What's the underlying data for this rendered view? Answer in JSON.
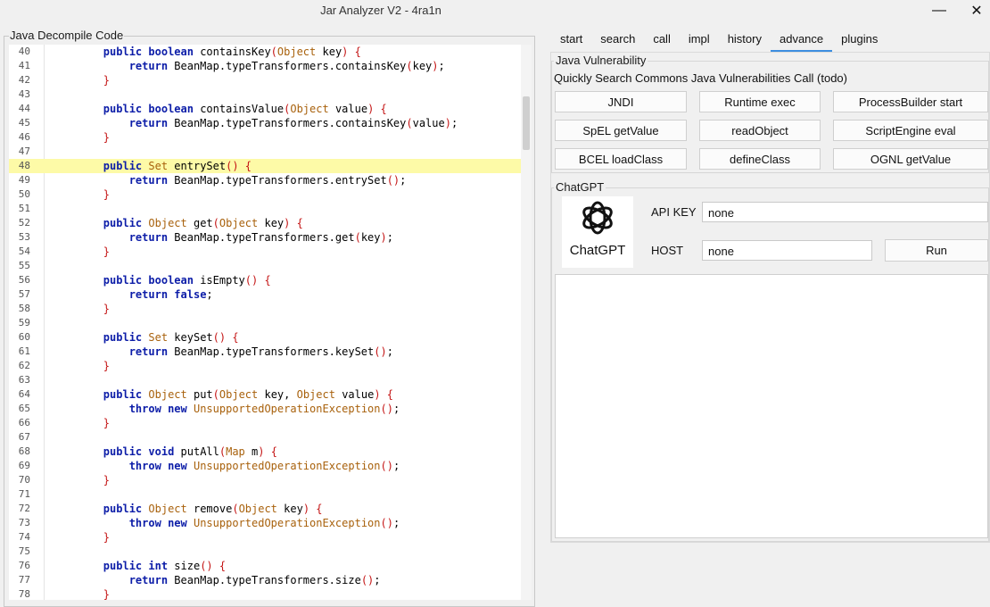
{
  "window": {
    "title": "Jar Analyzer V2 - 4ra1n",
    "minimize": "—",
    "close": "✕"
  },
  "left": {
    "legend": "Java Decompile Code"
  },
  "code_lines": [
    {
      "n": "40",
      "tokens": [
        [
          "i",
          "        "
        ],
        [
          "k",
          "public"
        ],
        [
          "n",
          " "
        ],
        [
          "k",
          "boolean"
        ],
        [
          "n",
          " containsKey"
        ],
        [
          "p",
          "("
        ],
        [
          "t",
          "Object"
        ],
        [
          "n",
          " key"
        ],
        [
          "p",
          ")"
        ],
        [
          "n",
          " "
        ],
        [
          "p",
          "{"
        ]
      ]
    },
    {
      "n": "41",
      "tokens": [
        [
          "i",
          "            "
        ],
        [
          "k",
          "return"
        ],
        [
          "n",
          " BeanMap.typeTransformers.containsKey"
        ],
        [
          "p",
          "("
        ],
        [
          "n",
          "key"
        ],
        [
          "p",
          ")"
        ],
        [
          "n",
          ";"
        ]
      ]
    },
    {
      "n": "42",
      "tokens": [
        [
          "i",
          "        "
        ],
        [
          "p",
          "}"
        ]
      ]
    },
    {
      "n": "43",
      "tokens": []
    },
    {
      "n": "44",
      "tokens": [
        [
          "i",
          "        "
        ],
        [
          "k",
          "public"
        ],
        [
          "n",
          " "
        ],
        [
          "k",
          "boolean"
        ],
        [
          "n",
          " containsValue"
        ],
        [
          "p",
          "("
        ],
        [
          "t",
          "Object"
        ],
        [
          "n",
          " value"
        ],
        [
          "p",
          ")"
        ],
        [
          "n",
          " "
        ],
        [
          "p",
          "{"
        ]
      ]
    },
    {
      "n": "45",
      "tokens": [
        [
          "i",
          "            "
        ],
        [
          "k",
          "return"
        ],
        [
          "n",
          " BeanMap.typeTransformers.containsKey"
        ],
        [
          "p",
          "("
        ],
        [
          "n",
          "value"
        ],
        [
          "p",
          ")"
        ],
        [
          "n",
          ";"
        ]
      ]
    },
    {
      "n": "46",
      "tokens": [
        [
          "i",
          "        "
        ],
        [
          "p",
          "}"
        ]
      ]
    },
    {
      "n": "47",
      "tokens": []
    },
    {
      "n": "48",
      "hl": true,
      "tokens": [
        [
          "i",
          "        "
        ],
        [
          "k",
          "public"
        ],
        [
          "n",
          " "
        ],
        [
          "t",
          "Set"
        ],
        [
          "n",
          " entrySet"
        ],
        [
          "p",
          "()"
        ],
        [
          "n",
          " "
        ],
        [
          "p",
          "{"
        ]
      ]
    },
    {
      "n": "49",
      "tokens": [
        [
          "i",
          "            "
        ],
        [
          "k",
          "return"
        ],
        [
          "n",
          " BeanMap.typeTransformers.entrySet"
        ],
        [
          "p",
          "()"
        ],
        [
          "n",
          ";"
        ]
      ]
    },
    {
      "n": "50",
      "tokens": [
        [
          "i",
          "        "
        ],
        [
          "p",
          "}"
        ]
      ]
    },
    {
      "n": "51",
      "tokens": []
    },
    {
      "n": "52",
      "tokens": [
        [
          "i",
          "        "
        ],
        [
          "k",
          "public"
        ],
        [
          "n",
          " "
        ],
        [
          "t",
          "Object"
        ],
        [
          "n",
          " get"
        ],
        [
          "p",
          "("
        ],
        [
          "t",
          "Object"
        ],
        [
          "n",
          " key"
        ],
        [
          "p",
          ")"
        ],
        [
          "n",
          " "
        ],
        [
          "p",
          "{"
        ]
      ]
    },
    {
      "n": "53",
      "tokens": [
        [
          "i",
          "            "
        ],
        [
          "k",
          "return"
        ],
        [
          "n",
          " BeanMap.typeTransformers.get"
        ],
        [
          "p",
          "("
        ],
        [
          "n",
          "key"
        ],
        [
          "p",
          ")"
        ],
        [
          "n",
          ";"
        ]
      ]
    },
    {
      "n": "54",
      "tokens": [
        [
          "i",
          "        "
        ],
        [
          "p",
          "}"
        ]
      ]
    },
    {
      "n": "55",
      "tokens": []
    },
    {
      "n": "56",
      "tokens": [
        [
          "i",
          "        "
        ],
        [
          "k",
          "public"
        ],
        [
          "n",
          " "
        ],
        [
          "k",
          "boolean"
        ],
        [
          "n",
          " isEmpty"
        ],
        [
          "p",
          "()"
        ],
        [
          "n",
          " "
        ],
        [
          "p",
          "{"
        ]
      ]
    },
    {
      "n": "57",
      "tokens": [
        [
          "i",
          "            "
        ],
        [
          "k",
          "return"
        ],
        [
          "n",
          " "
        ],
        [
          "k",
          "false"
        ],
        [
          "n",
          ";"
        ]
      ]
    },
    {
      "n": "58",
      "tokens": [
        [
          "i",
          "        "
        ],
        [
          "p",
          "}"
        ]
      ]
    },
    {
      "n": "59",
      "tokens": []
    },
    {
      "n": "60",
      "tokens": [
        [
          "i",
          "        "
        ],
        [
          "k",
          "public"
        ],
        [
          "n",
          " "
        ],
        [
          "t",
          "Set"
        ],
        [
          "n",
          " keySet"
        ],
        [
          "p",
          "()"
        ],
        [
          "n",
          " "
        ],
        [
          "p",
          "{"
        ]
      ]
    },
    {
      "n": "61",
      "tokens": [
        [
          "i",
          "            "
        ],
        [
          "k",
          "return"
        ],
        [
          "n",
          " BeanMap.typeTransformers.keySet"
        ],
        [
          "p",
          "()"
        ],
        [
          "n",
          ";"
        ]
      ]
    },
    {
      "n": "62",
      "tokens": [
        [
          "i",
          "        "
        ],
        [
          "p",
          "}"
        ]
      ]
    },
    {
      "n": "63",
      "tokens": []
    },
    {
      "n": "64",
      "tokens": [
        [
          "i",
          "        "
        ],
        [
          "k",
          "public"
        ],
        [
          "n",
          " "
        ],
        [
          "t",
          "Object"
        ],
        [
          "n",
          " put"
        ],
        [
          "p",
          "("
        ],
        [
          "t",
          "Object"
        ],
        [
          "n",
          " key, "
        ],
        [
          "t",
          "Object"
        ],
        [
          "n",
          " value"
        ],
        [
          "p",
          ")"
        ],
        [
          "n",
          " "
        ],
        [
          "p",
          "{"
        ]
      ]
    },
    {
      "n": "65",
      "tokens": [
        [
          "i",
          "            "
        ],
        [
          "k",
          "throw"
        ],
        [
          "n",
          " "
        ],
        [
          "k",
          "new"
        ],
        [
          "n",
          " "
        ],
        [
          "t",
          "UnsupportedOperationException"
        ],
        [
          "p",
          "()"
        ],
        [
          "n",
          ";"
        ]
      ]
    },
    {
      "n": "66",
      "tokens": [
        [
          "i",
          "        "
        ],
        [
          "p",
          "}"
        ]
      ]
    },
    {
      "n": "67",
      "tokens": []
    },
    {
      "n": "68",
      "tokens": [
        [
          "i",
          "        "
        ],
        [
          "k",
          "public"
        ],
        [
          "n",
          " "
        ],
        [
          "k",
          "void"
        ],
        [
          "n",
          " putAll"
        ],
        [
          "p",
          "("
        ],
        [
          "t",
          "Map"
        ],
        [
          "n",
          " m"
        ],
        [
          "p",
          ")"
        ],
        [
          "n",
          " "
        ],
        [
          "p",
          "{"
        ]
      ]
    },
    {
      "n": "69",
      "tokens": [
        [
          "i",
          "            "
        ],
        [
          "k",
          "throw"
        ],
        [
          "n",
          " "
        ],
        [
          "k",
          "new"
        ],
        [
          "n",
          " "
        ],
        [
          "t",
          "UnsupportedOperationException"
        ],
        [
          "p",
          "()"
        ],
        [
          "n",
          ";"
        ]
      ]
    },
    {
      "n": "70",
      "tokens": [
        [
          "i",
          "        "
        ],
        [
          "p",
          "}"
        ]
      ]
    },
    {
      "n": "71",
      "tokens": []
    },
    {
      "n": "72",
      "tokens": [
        [
          "i",
          "        "
        ],
        [
          "k",
          "public"
        ],
        [
          "n",
          " "
        ],
        [
          "t",
          "Object"
        ],
        [
          "n",
          " remove"
        ],
        [
          "p",
          "("
        ],
        [
          "t",
          "Object"
        ],
        [
          "n",
          " key"
        ],
        [
          "p",
          ")"
        ],
        [
          "n",
          " "
        ],
        [
          "p",
          "{"
        ]
      ]
    },
    {
      "n": "73",
      "tokens": [
        [
          "i",
          "            "
        ],
        [
          "k",
          "throw"
        ],
        [
          "n",
          " "
        ],
        [
          "k",
          "new"
        ],
        [
          "n",
          " "
        ],
        [
          "t",
          "UnsupportedOperationException"
        ],
        [
          "p",
          "()"
        ],
        [
          "n",
          ";"
        ]
      ]
    },
    {
      "n": "74",
      "tokens": [
        [
          "i",
          "        "
        ],
        [
          "p",
          "}"
        ]
      ]
    },
    {
      "n": "75",
      "tokens": []
    },
    {
      "n": "76",
      "tokens": [
        [
          "i",
          "        "
        ],
        [
          "k",
          "public"
        ],
        [
          "n",
          " "
        ],
        [
          "k",
          "int"
        ],
        [
          "n",
          " size"
        ],
        [
          "p",
          "()"
        ],
        [
          "n",
          " "
        ],
        [
          "p",
          "{"
        ]
      ]
    },
    {
      "n": "77",
      "tokens": [
        [
          "i",
          "            "
        ],
        [
          "k",
          "return"
        ],
        [
          "n",
          " BeanMap.typeTransformers.size"
        ],
        [
          "p",
          "()"
        ],
        [
          "n",
          ";"
        ]
      ]
    },
    {
      "n": "78",
      "tokens": [
        [
          "i",
          "        "
        ],
        [
          "p",
          "}"
        ]
      ]
    }
  ],
  "tabs": [
    "start",
    "search",
    "call",
    "impl",
    "history",
    "advance",
    "plugins"
  ],
  "active_tab": "advance",
  "vuln": {
    "legend": "Java Vulnerability",
    "subtitle": "Quickly Search Commons Java Vulnerabilities Call (todo)",
    "buttons": [
      "JNDI",
      "Runtime exec",
      "ProcessBuilder start",
      "SpEL getValue",
      "readObject",
      "ScriptEngine eval",
      "BCEL loadClass",
      "defineClass",
      "OGNL getValue"
    ]
  },
  "chatgpt": {
    "legend": "ChatGPT",
    "logo_text": "ChatGPT",
    "api_key_label": "API KEY",
    "api_key_value": "none",
    "host_label": "HOST",
    "host_value": "none",
    "run_label": "Run",
    "output": ""
  },
  "colors": {
    "keyword": "#0c1da8",
    "type": "#a8610c",
    "paren": "#c41414",
    "highlight": "#fdfaa7",
    "tab_underline": "#3d8ee0"
  }
}
